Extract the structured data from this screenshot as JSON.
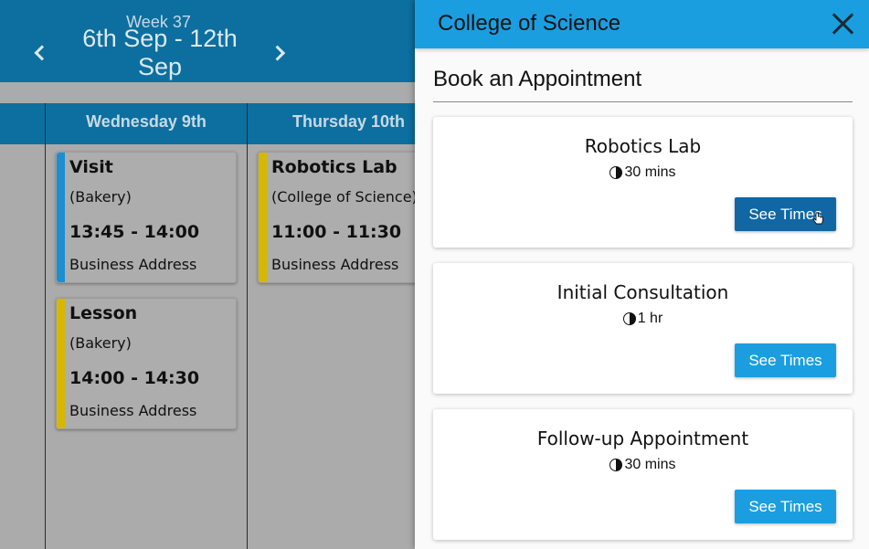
{
  "calendar": {
    "week_label": "Week 37",
    "date_range": "6th Sep - 12th Sep",
    "days": [
      {
        "label": "Wednesday 9th"
      },
      {
        "label": "Thursday 10th"
      }
    ],
    "events": [
      {
        "title": "Visit",
        "location": "(Bakery)",
        "time": "13:45 - 14:00",
        "address": "Business Address",
        "color": "#1b8fd0"
      },
      {
        "title": "Lesson",
        "location": "(Bakery)",
        "time": "14:00 - 14:30",
        "address": "Business Address",
        "color": "#d6b800"
      },
      {
        "title": "Robotics Lab",
        "location": "(College of Science)",
        "time": "11:00 - 11:30",
        "address": "Business Address",
        "color": "#d6b800"
      }
    ]
  },
  "panel": {
    "title": "College of Science",
    "section_title": "Book an Appointment",
    "cards": [
      {
        "name": "Robotics Lab",
        "duration": "30 mins",
        "button": "See Times"
      },
      {
        "name": "Initial Consultation",
        "duration": "1 hr",
        "button": "See Times"
      },
      {
        "name": "Follow-up Appointment",
        "duration": "30 mins",
        "button": "See Times"
      }
    ]
  },
  "colors": {
    "header_blue": "#0c6fa0",
    "panel_blue": "#1a9ee0",
    "button_hover": "#1167a3"
  },
  "icons": [
    "chevron-left-icon",
    "chevron-right-icon",
    "close-icon",
    "clock-icon",
    "pointer-cursor-icon"
  ]
}
